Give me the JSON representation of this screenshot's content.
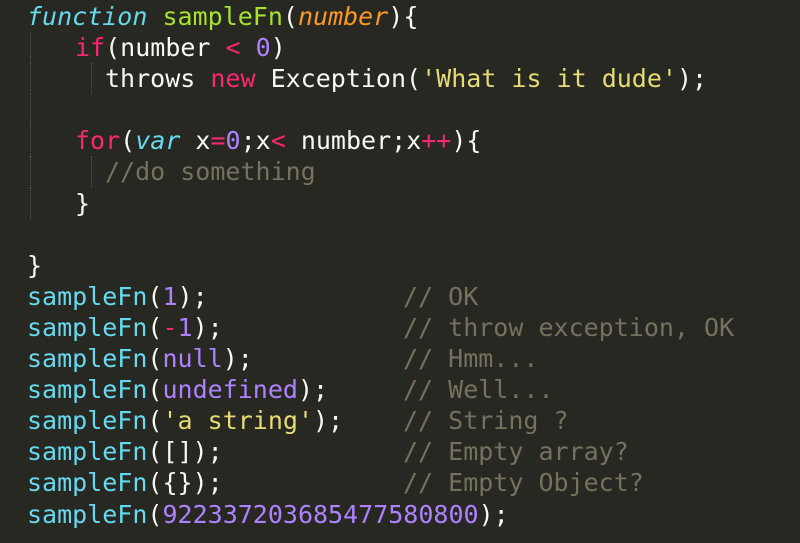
{
  "theme": {
    "background": "#272822",
    "foreground": "#f8f8f2",
    "keyword": "#f92672",
    "storage": "#66d9ef",
    "function_name": "#a6e22e",
    "parameter": "#fd971f",
    "number": "#ae81ff",
    "string": "#e6db74",
    "comment": "#75715e"
  },
  "code": {
    "l1": {
      "kw": "function",
      "name": "sampleFn",
      "open": "(",
      "param": "number",
      "close": "){"
    },
    "l2": {
      "kw": "if",
      "open": "(",
      "var": "number ",
      "op": "<",
      "sp": " ",
      "num": "0",
      "close": ")"
    },
    "l3": {
      "throws": "throws ",
      "new": "new",
      "cls": " Exception(",
      "str": "'What is it dude'",
      "close": ");"
    },
    "l4": {},
    "l5": {
      "kw": "for",
      "open": "(",
      "var_kw": "var",
      "x": " x",
      "eq": "=",
      "zero": "0",
      "mid": ";x",
      "lt": "<",
      "rest": " number;x",
      "inc": "++",
      "close": "){"
    },
    "l6": {
      "comment": "//do something"
    },
    "l7": {
      "brace": "}"
    },
    "l8": {},
    "l9": {
      "brace": "}"
    },
    "calls": [
      {
        "fn": "sampleFn",
        "open": "(",
        "arg": "1",
        "arg_type": "num",
        "close": ");",
        "comment": "// OK"
      },
      {
        "fn": "sampleFn",
        "open": "(",
        "arg": "-1",
        "arg_type": "neg",
        "close": ");",
        "comment": "// throw exception, OK"
      },
      {
        "fn": "sampleFn",
        "open": "(",
        "arg": "null",
        "arg_type": "num",
        "close": ");",
        "comment": "// Hmm..."
      },
      {
        "fn": "sampleFn",
        "open": "(",
        "arg": "undefined",
        "arg_type": "num",
        "close": ");",
        "comment": "// Well..."
      },
      {
        "fn": "sampleFn",
        "open": "(",
        "arg": "'a string'",
        "arg_type": "str",
        "close": ");",
        "comment": "// String ?"
      },
      {
        "fn": "sampleFn",
        "open": "(",
        "arg": "[]",
        "arg_type": "plain",
        "close": ");",
        "comment": "// Empty array?"
      },
      {
        "fn": "sampleFn",
        "open": "(",
        "arg": "{}",
        "arg_type": "plain",
        "close": ");",
        "comment": "// Empty Object?"
      },
      {
        "fn": "sampleFn",
        "open": "(",
        "arg": "922337203685477580800",
        "arg_type": "num",
        "close": ");",
        "comment": ""
      }
    ],
    "neg_sign": "-",
    "neg_value": "1"
  }
}
